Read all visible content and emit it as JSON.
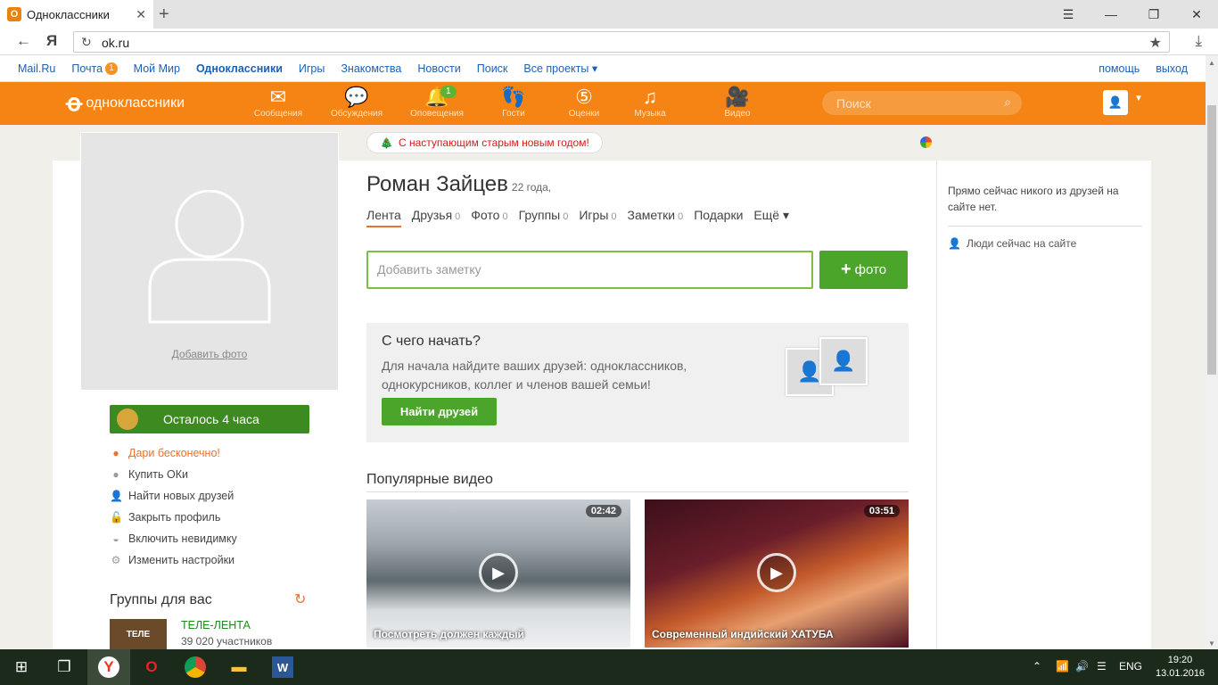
{
  "browser": {
    "tab_title": "Одноклассники",
    "tab_favicon": "ok-icon",
    "address": "ok.ru",
    "yandex_letter": "Я"
  },
  "portal_bar": {
    "links": [
      {
        "label": "Mail.Ru"
      },
      {
        "label": "Почта",
        "badge": "1"
      },
      {
        "label": "Мой Мир"
      },
      {
        "label": "Одноклассники",
        "bold": true
      },
      {
        "label": "Игры"
      },
      {
        "label": "Знакомства"
      },
      {
        "label": "Новости"
      },
      {
        "label": "Поиск"
      },
      {
        "label": "Все проекты ▾"
      }
    ],
    "help": "помощь",
    "logout": "выход"
  },
  "toolbar": {
    "logo_text": "одноклассники",
    "items": [
      {
        "label": "Сообщения",
        "icon": "envelope-icon"
      },
      {
        "label": "Обсуждения",
        "icon": "chat-icon"
      },
      {
        "label": "Оповещения",
        "icon": "bell-icon",
        "count": "1"
      },
      {
        "label": "Гости",
        "icon": "footprints-icon"
      },
      {
        "label": "Оценки",
        "icon": "rating-icon"
      },
      {
        "label": "Музыка",
        "icon": "music-icon"
      },
      {
        "label": "Видео",
        "icon": "video-camera-icon"
      }
    ],
    "search_placeholder": "Поиск"
  },
  "left": {
    "add_photo": "Добавить фото",
    "promo_text": "Осталось 4 часа",
    "menu": [
      {
        "label": "Дари бесконечно!",
        "icon": "gift-icon",
        "orange": true
      },
      {
        "label": "Купить ОКи",
        "icon": "coin-icon"
      },
      {
        "label": "Найти новых друзей",
        "icon": "person-icon"
      },
      {
        "label": "Закрыть профиль",
        "icon": "lock-icon"
      },
      {
        "label": "Включить невидимку",
        "icon": "hat-icon"
      },
      {
        "label": "Изменить настройки",
        "icon": "gear-icon"
      }
    ],
    "groups_title": "Группы для вас",
    "group": {
      "name": "ТЕЛЕ-ЛЕНТА",
      "count": "39 020 участников",
      "thumb_text": "ТЕЛЕ"
    }
  },
  "center": {
    "holiday_text": "С наступающим старым новым годом!",
    "name": "Роман Зайцев",
    "age": "22 года,",
    "tabs": [
      {
        "label": "Лента",
        "active": true
      },
      {
        "label": "Друзья",
        "n": "0"
      },
      {
        "label": "Фото",
        "n": "0"
      },
      {
        "label": "Группы",
        "n": "0"
      },
      {
        "label": "Игры",
        "n": "0"
      },
      {
        "label": "Заметки",
        "n": "0"
      },
      {
        "label": "Подарки"
      },
      {
        "label": "Ещё ▾"
      }
    ],
    "note_placeholder": "Добавить заметку",
    "photo_button": "фото",
    "start": {
      "title": "С чего начать?",
      "desc": "Для начала найдите ваших друзей: одноклассников, однокурсников, коллег и членов вашей семьи!",
      "button": "Найти друзей"
    },
    "videos_title": "Популярные видео",
    "videos": [
      {
        "title": "Посмотреть должен каждый",
        "duration": "02:42"
      },
      {
        "title": "Современный индийский ХАТУБА",
        "duration": "03:51"
      }
    ]
  },
  "right": {
    "no_friends": "Прямо сейчас никого из друзей на сайте нет.",
    "online_link": "Люди сейчас на сайте"
  },
  "taskbar": {
    "lang": "ENG",
    "time": "19:20",
    "date": "13.01.2016"
  },
  "colors": {
    "ok_orange": "#f68414",
    "green": "#4aa52a",
    "link_blue": "#1a61b6"
  }
}
